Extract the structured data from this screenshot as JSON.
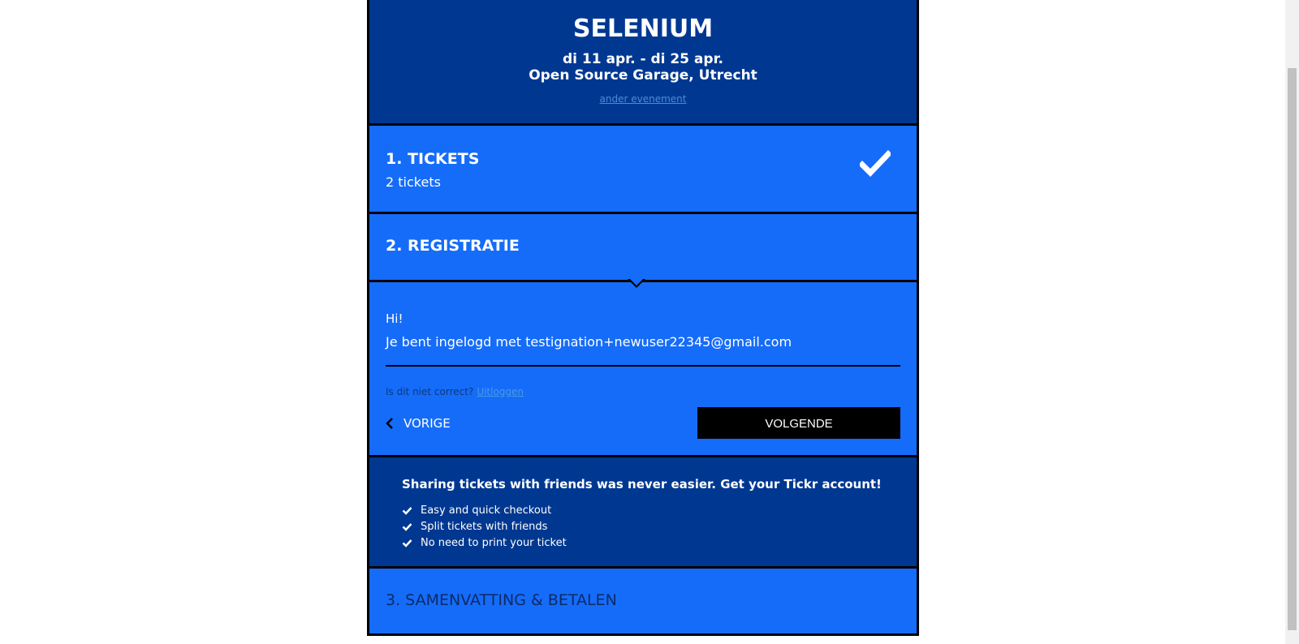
{
  "event": {
    "title": "SELENIUM",
    "dates": "di 11 apr. - di 25 apr.",
    "location": "Open Source Garage, Utrecht",
    "change_link": "ander evenement"
  },
  "steps": [
    {
      "label": "1. TICKETS",
      "summary": "2 tickets",
      "completed": true
    },
    {
      "label": "2. REGISTRATIE",
      "active": true
    },
    {
      "label": "3. SAMENVATTING & BETALEN"
    }
  ],
  "registration": {
    "greeting": "Hi!",
    "logged_in_text": "Je bent ingelogd met testignation+newuser22345@gmail.com",
    "not_correct_text": "Is dit niet correct?",
    "logout_link": "Uitloggen",
    "prev_label": "VORIGE",
    "next_label": "VOLGENDE"
  },
  "promo": {
    "title": "Sharing tickets with friends was never easier. Get your Tickr account!",
    "items": [
      "Easy and quick checkout",
      "Split tickets with friends",
      "No need to print your ticket"
    ]
  },
  "icons": {
    "step_complete": "checkmark-icon",
    "prev": "chevron-left-icon",
    "list_bullet": "checkmark-icon"
  },
  "colors": {
    "header_bg": "#003891",
    "step_bg": "#156cf9",
    "button_bg": "#000000",
    "text": "#ffffff"
  }
}
